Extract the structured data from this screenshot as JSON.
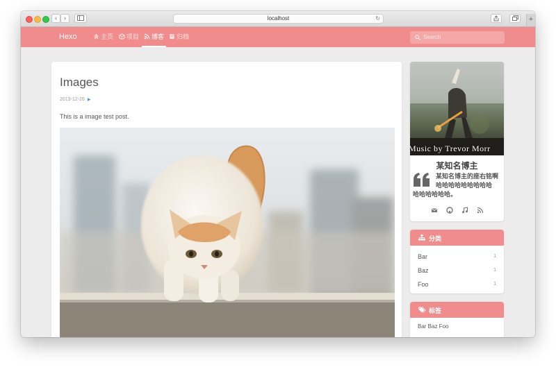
{
  "browser": {
    "url": "localhost",
    "back_icon": "chevron-left-icon",
    "forward_icon": "chevron-right-icon"
  },
  "navbar": {
    "brand": "Hexo",
    "items": [
      {
        "label": "主页",
        "icon": "home-icon"
      },
      {
        "label": "项目",
        "icon": "cube-icon"
      },
      {
        "label": "博客",
        "icon": "rss-icon"
      },
      {
        "label": "归档",
        "icon": "archive-icon"
      }
    ],
    "search_placeholder": "Search"
  },
  "post": {
    "title": "Images",
    "date": "2013-12-26",
    "text": "This is a image test post."
  },
  "profile": {
    "image_caption": "Music by Trevor Morr",
    "name": "某知名博主",
    "bio_line1": "某知名博主的座右铭啊哈哈哈哈哈哈哈哈哈",
    "bio_line2": "哈哈哈哈哈哈。",
    "social_icons": [
      "envelope-icon",
      "github-icon",
      "music-icon",
      "rss-icon"
    ]
  },
  "categories": {
    "title": "分类",
    "items": [
      {
        "name": "Bar",
        "count": "1"
      },
      {
        "name": "Baz",
        "count": "1"
      },
      {
        "name": "Foo",
        "count": "1"
      }
    ]
  },
  "tags": {
    "title": "标签",
    "list": "Bar Baz Foo"
  },
  "colors": {
    "accent": "#f08c8c",
    "background": "#ececec"
  }
}
